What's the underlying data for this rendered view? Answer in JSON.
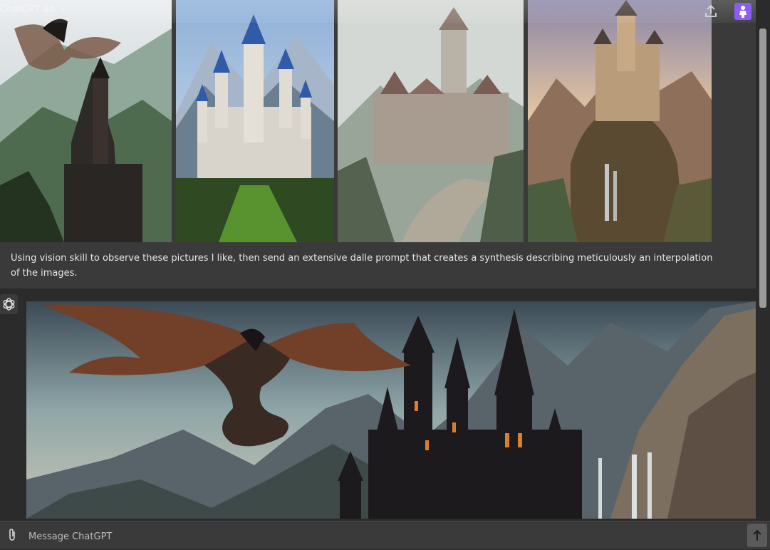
{
  "topbar": {
    "title": "ChatGPT 4o",
    "title_chevron": "∨",
    "share_icon": "share-icon",
    "avatar_icon": "user-avatar-icon"
  },
  "user_message": {
    "images": [
      {
        "label": "dark castle on mountain with dragon"
      },
      {
        "label": "white castle with blue spires"
      },
      {
        "label": "stone castle with winding road"
      },
      {
        "label": "castle on cliff with waterfalls"
      }
    ],
    "text": "Using vision skill to observe these pictures I like, then send an extensive dalle prompt that creates a synthesis describing meticulously an interpolation of the images."
  },
  "assistant_message": {
    "icon": "openai-logo-icon",
    "image_label": "dragon over gothic castle with waterfalls"
  },
  "composer": {
    "placeholder": "Message ChatGPT",
    "attach_icon": "paperclip-icon",
    "send_icon": "arrow-up-icon"
  },
  "colors": {
    "background": "#2b2b2b",
    "message_bg": "#3a3a3a",
    "avatar": "#8b5cf6"
  }
}
